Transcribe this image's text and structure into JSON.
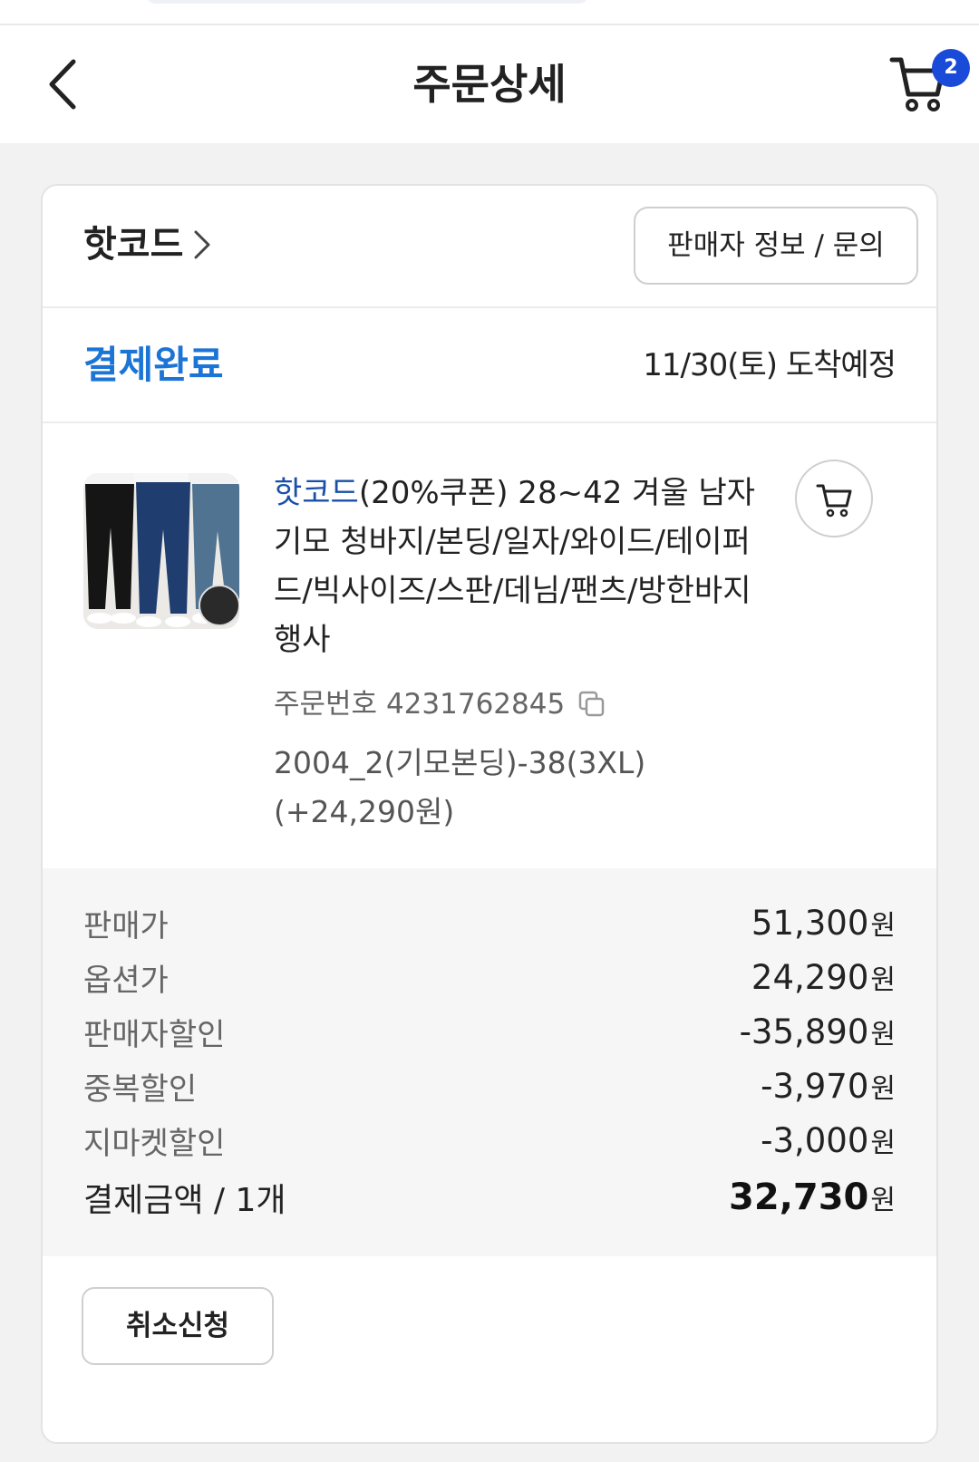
{
  "header": {
    "title": "주문상세",
    "cart_count": "2"
  },
  "seller": {
    "name": "핫코드",
    "info_button": "판매자 정보 / 문의"
  },
  "order_status": {
    "status": "결제완료",
    "arrival": "11/30(토) 도착예정"
  },
  "product": {
    "brand": "핫코드",
    "title": "(20%쿠폰) 28~42 겨울 남자 기모 청바지/본딩/일자/와이드/테이퍼드/빅사이즈/스판/데님/팬츠/방한바지 행사",
    "order_number_label": "주문번호",
    "order_number": "4231762845",
    "option": "2004_2(기모본딩)-38(3XL)",
    "option_price": "(+24,290원)"
  },
  "price_summary": {
    "rows": [
      {
        "label": "판매가",
        "value": "51,300",
        "unit": "원"
      },
      {
        "label": "옵션가",
        "value": "24,290",
        "unit": "원"
      },
      {
        "label": "판매자할인",
        "value": "-35,890",
        "unit": "원"
      },
      {
        "label": "중복할인",
        "value": "-3,970",
        "unit": "원"
      },
      {
        "label": "지마켓할인",
        "value": "-3,000",
        "unit": "원"
      }
    ],
    "total": {
      "label": "결제금액 / 1개",
      "value": "32,730",
      "unit": "원"
    }
  },
  "actions": {
    "cancel": "취소신청"
  },
  "colors": {
    "status_blue": "#1c74d6",
    "brand_blue": "#1a4fa8",
    "badge_blue": "#1a4ad8"
  },
  "icons": [
    "back-arrow-icon",
    "cart-icon",
    "chevron-right-icon",
    "add-to-cart-icon",
    "copy-icon"
  ]
}
